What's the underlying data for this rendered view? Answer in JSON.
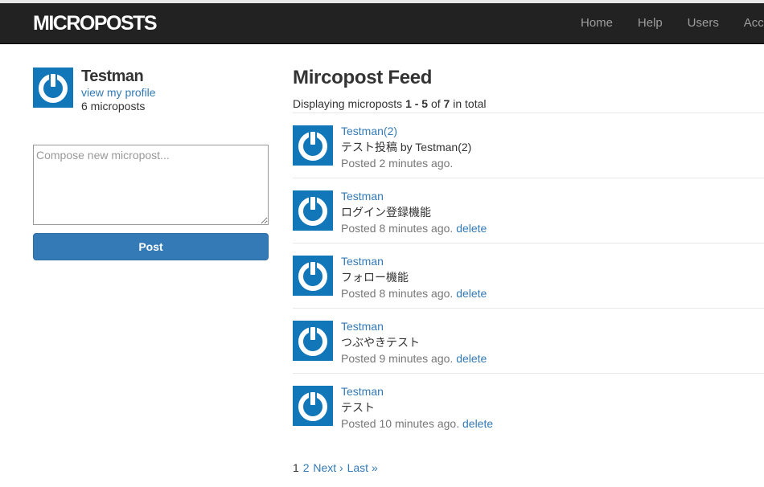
{
  "app": {
    "brand": "MICROPOSTS",
    "nav": [
      "Home",
      "Help",
      "Users",
      "Account"
    ],
    "colors": {
      "navbar": "#222222",
      "link": "#337ab7",
      "primary_button": "#337ab7",
      "avatar_bg": "#1277b8"
    }
  },
  "sidebar": {
    "user_name": "Testman",
    "profile_link": "view my profile",
    "post_count": "6 microposts",
    "avatar_icon": "gravatar-power-icon",
    "compose_placeholder": "Compose new micropost...",
    "compose_value": "",
    "post_button": "Post"
  },
  "feed": {
    "title": "Mircopost Feed",
    "summary": {
      "prefix": "Displaying microposts ",
      "range": "1 - 5",
      "middle": " of ",
      "total": "7",
      "suffix": " in total"
    },
    "items": [
      {
        "user": "Testman(2)",
        "content": "テスト投稿 by Testman(2)",
        "timestamp": "Posted 2 minutes ago.",
        "delete": ""
      },
      {
        "user": "Testman",
        "content": "ログイン登録機能",
        "timestamp": "Posted 8 minutes ago.",
        "delete": "delete"
      },
      {
        "user": "Testman",
        "content": "フォロー機能",
        "timestamp": "Posted 8 minutes ago.",
        "delete": "delete"
      },
      {
        "user": "Testman",
        "content": "つぶやきテスト",
        "timestamp": "Posted 9 minutes ago.",
        "delete": "delete"
      },
      {
        "user": "Testman",
        "content": "テスト",
        "timestamp": "Posted 10 minutes ago.",
        "delete": "delete"
      }
    ]
  },
  "pagination": {
    "current": "1",
    "page2": "2",
    "next": "Next ›",
    "last": "Last »"
  }
}
